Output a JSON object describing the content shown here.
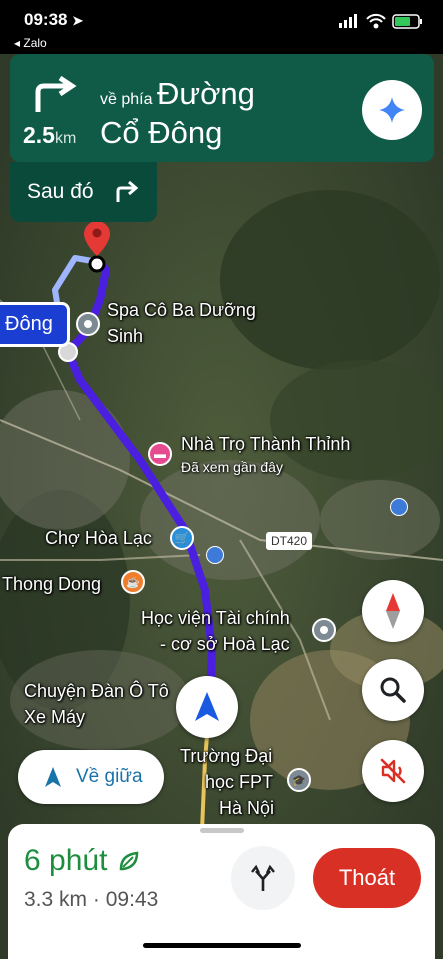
{
  "status_bar": {
    "time": "09:38",
    "back_app": "◂ Zalo"
  },
  "navigation": {
    "direction_prefix": "về phía",
    "street_line1": "Đường",
    "street_line2": "Cổ Đông",
    "distance_value": "2.5",
    "distance_unit": "km",
    "then_label": "Sau đó"
  },
  "map": {
    "current_street_tag": "Đông",
    "road_shield": "DT420",
    "places": [
      {
        "name_line1": "Spa Cô Ba Dưỡng",
        "name_line2": "Sinh"
      },
      {
        "name": "Nhà Trọ Thành Thỉnh",
        "subtitle": "Đã xem gần đây"
      },
      {
        "name": "Chợ Hòa Lạc"
      },
      {
        "name": "Thong Dong"
      },
      {
        "name_line1": "Học viện Tài chính",
        "name_line2": "- cơ sở Hoà Lạc"
      },
      {
        "name_line1": "Chuyện Đàn Ô Tô",
        "name_line2": "Xe Máy"
      },
      {
        "name_line1": "Trường Đại",
        "name_line2": "học FPT",
        "name_line3": "Hà Nội"
      }
    ]
  },
  "controls": {
    "recenter_label": "Về giữa"
  },
  "trip": {
    "eta_minutes": "6 phút",
    "distance": "3.3 km",
    "separator": "·",
    "arrival_time": "09:43",
    "exit_label": "Thoát"
  },
  "colors": {
    "banner": "#0f5b47",
    "route": "#4b1fe0",
    "exit": "#d93025",
    "eta": "#1e8e3e"
  }
}
